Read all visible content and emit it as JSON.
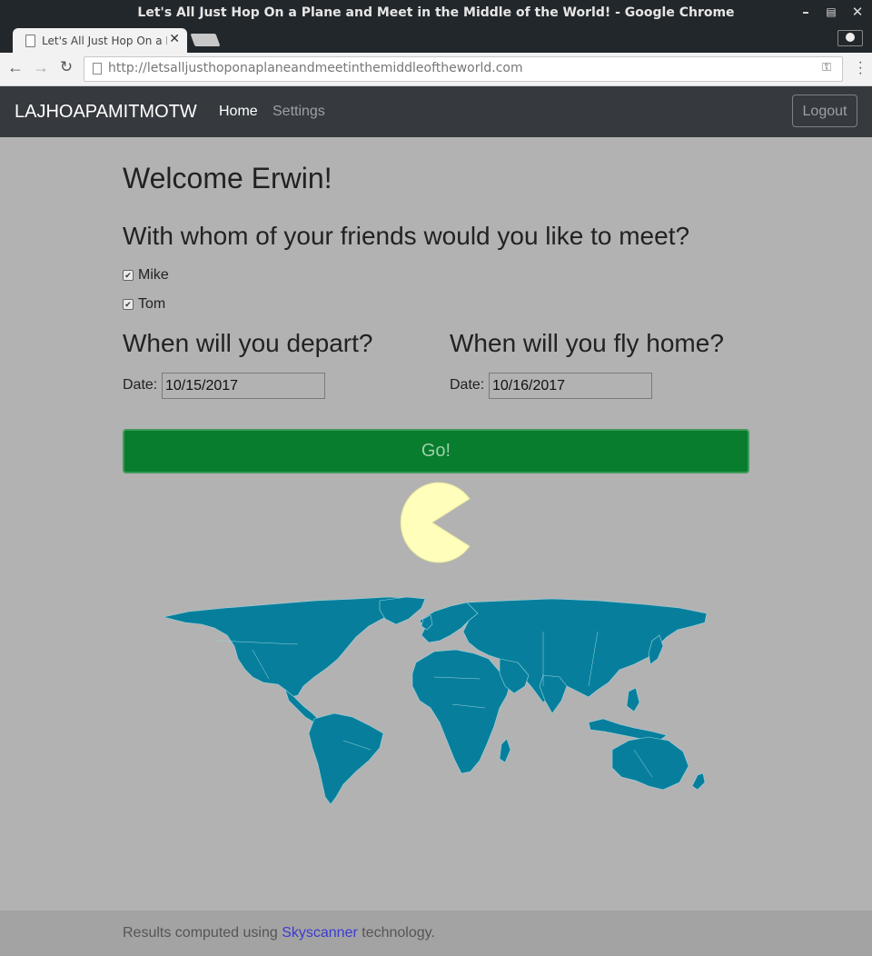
{
  "window": {
    "title": "Let's All Just Hop On a Plane and Meet in the Middle of the World! - Google Chrome",
    "tab_title": "Let's All Just Hop On a Plane and Meet in the Middle of the World!",
    "url": "http://letsalljusthoponaplaneandmeetinthemiddleoftheworld.com"
  },
  "navbar": {
    "brand": "LAJHOAPAMITMOTW",
    "home": "Home",
    "settings": "Settings",
    "logout": "Logout"
  },
  "main": {
    "welcome": "Welcome Erwin!",
    "friends_question": "With whom of your friends would you like to meet?",
    "friends": [
      {
        "name": "Mike",
        "checked": true
      },
      {
        "name": "Tom",
        "checked": true
      }
    ],
    "depart": {
      "heading": "When will you depart?",
      "label": "Date:",
      "value": "10/15/2017"
    },
    "return": {
      "heading": "When will you fly home?",
      "label": "Date:",
      "value": "10/16/2017"
    },
    "go_label": "Go!"
  },
  "footer": {
    "prefix": "Results computed using ",
    "link": "Skyscanner",
    "suffix": " technology."
  },
  "colors": {
    "page_bg": "#b2b2b2",
    "navbar_bg": "#363a3e",
    "go_button": "#077d2d",
    "map_fill": "#077f9c",
    "pacman": "#ffffbb",
    "link": "#3b3bd0"
  },
  "icons": [
    "back-arrow-icon",
    "forward-arrow-icon",
    "reload-icon",
    "key-icon",
    "menu-icon",
    "profile-icon",
    "close-icon"
  ]
}
